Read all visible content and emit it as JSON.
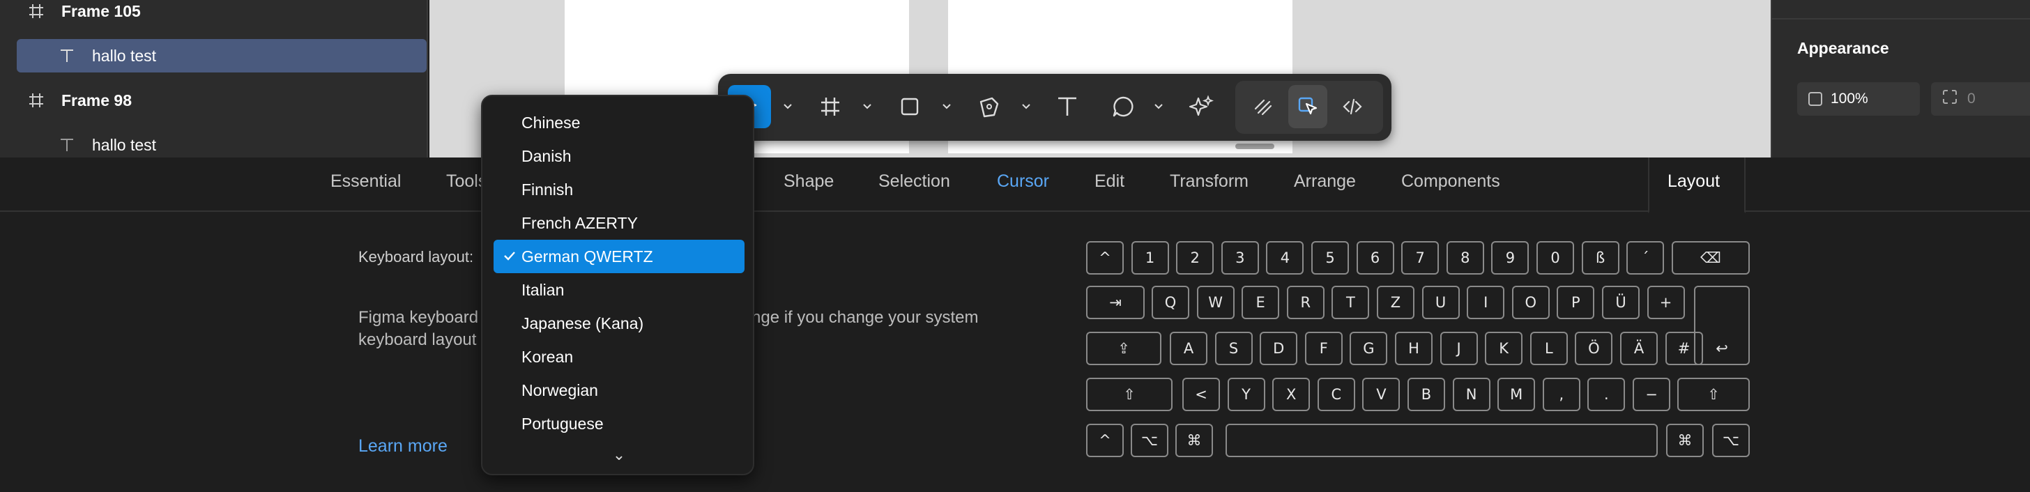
{
  "layers": [
    {
      "name": "Frame 105",
      "kind": "frame"
    },
    {
      "name": "hallo test",
      "kind": "text",
      "selected": true
    },
    {
      "name": "Frame 98",
      "kind": "frame"
    },
    {
      "name": "hallo test",
      "kind": "text"
    }
  ],
  "appearance": {
    "title": "Appearance",
    "opacity": "100%",
    "radius": "0"
  },
  "tabs": [
    "Essential",
    "Tools",
    "Shape",
    "Selection",
    "Cursor",
    "Edit",
    "Transform",
    "Arrange",
    "Components",
    "Layout"
  ],
  "settings": {
    "label": "Keyboard layout:",
    "desc_line1_a": "Figma keyboard",
    "desc_line1_b": "nge if you change your system",
    "desc_line2": "keyboard layout",
    "learn_more": "Learn more"
  },
  "dropdown": {
    "options": [
      "Chinese",
      "Danish",
      "Finnish",
      "French AZERTY",
      "German QWERTZ",
      "Italian",
      "Japanese (Kana)",
      "Korean",
      "Norwegian",
      "Portuguese"
    ],
    "selected": "German QWERTZ",
    "more_indicator": "⌄"
  },
  "keyboard": {
    "row1": [
      "^",
      "1",
      "2",
      "3",
      "4",
      "5",
      "6",
      "7",
      "8",
      "9",
      "0",
      "ß",
      "´",
      "⌫"
    ],
    "row2": [
      "⇥",
      "Q",
      "W",
      "E",
      "R",
      "T",
      "Z",
      "U",
      "I",
      "O",
      "P",
      "Ü",
      "+"
    ],
    "row3": [
      "⇪",
      "A",
      "S",
      "D",
      "F",
      "G",
      "H",
      "J",
      "K",
      "L",
      "Ö",
      "Ä",
      "#"
    ],
    "row4": [
      "⇧",
      "<",
      "Y",
      "X",
      "C",
      "V",
      "B",
      "N",
      "M",
      ",",
      ".",
      "−",
      "⇧"
    ],
    "row5": [
      "^",
      "⌥",
      "⌘",
      "",
      "⌘",
      "⌥"
    ],
    "enter": "↩"
  },
  "colors": {
    "accent": "#0d86e0",
    "selected_layer": "#4a5a7e",
    "link": "#5aa7f5"
  }
}
